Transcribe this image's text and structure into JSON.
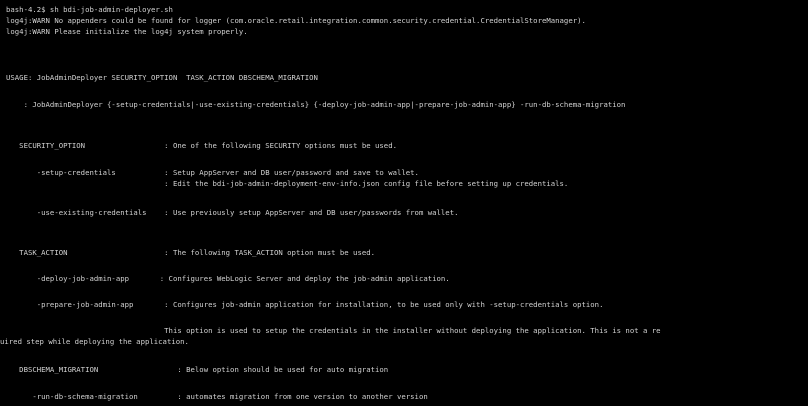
{
  "terminal": {
    "background": "#000000",
    "foreground": "#d2d2d2",
    "lines": [
      "bash-4.2$ sh bdi-job-admin-deployer.sh",
      "log4j:WARN No appenders could be found for logger (com.oracle.retail.integration.common.security.credential.CredentialStoreManager).",
      "log4j:WARN Please initialize the log4j system properly.",
      "USAGE: JobAdminDeployer SECURITY_OPTION  TASK_ACTION DBSCHEMA_MIGRATION",
      "    : JobAdminDeployer {-setup-credentials|-use-existing-credentials} {-deploy-job-admin-app|-prepare-job-admin-app} -run-db-schema-migration",
      "   SECURITY_OPTION                  : One of the following SECURITY options must be used.",
      "       -setup-credentials           : Setup AppServer and DB user/password and save to wallet.",
      "                                    : Edit the bdi-job-admin-deployment-env-info.json config file before setting up credentials.",
      "       -use-existing-credentials    : Use previously setup AppServer and DB user/passwords from wallet.",
      "   TASK_ACTION                      : The following TASK_ACTION option must be used.",
      "       -deploy-job-admin-app       : Configures WebLogic Server and deploy the job-admin application.",
      "       -prepare-job-admin-app       : Configures job-admin application for installation, to be used only with -setup-credentials option.",
      "                                    This option is used to setup the credentials in the installer without deploying the application. This is not a re",
      "uired step while deploying the application.",
      "   DBSCHEMA_MIGRATION                  : Below option should be used for auto migration",
      "      -run-db-schema-migration         : automates migration from one version to another version"
    ]
  }
}
